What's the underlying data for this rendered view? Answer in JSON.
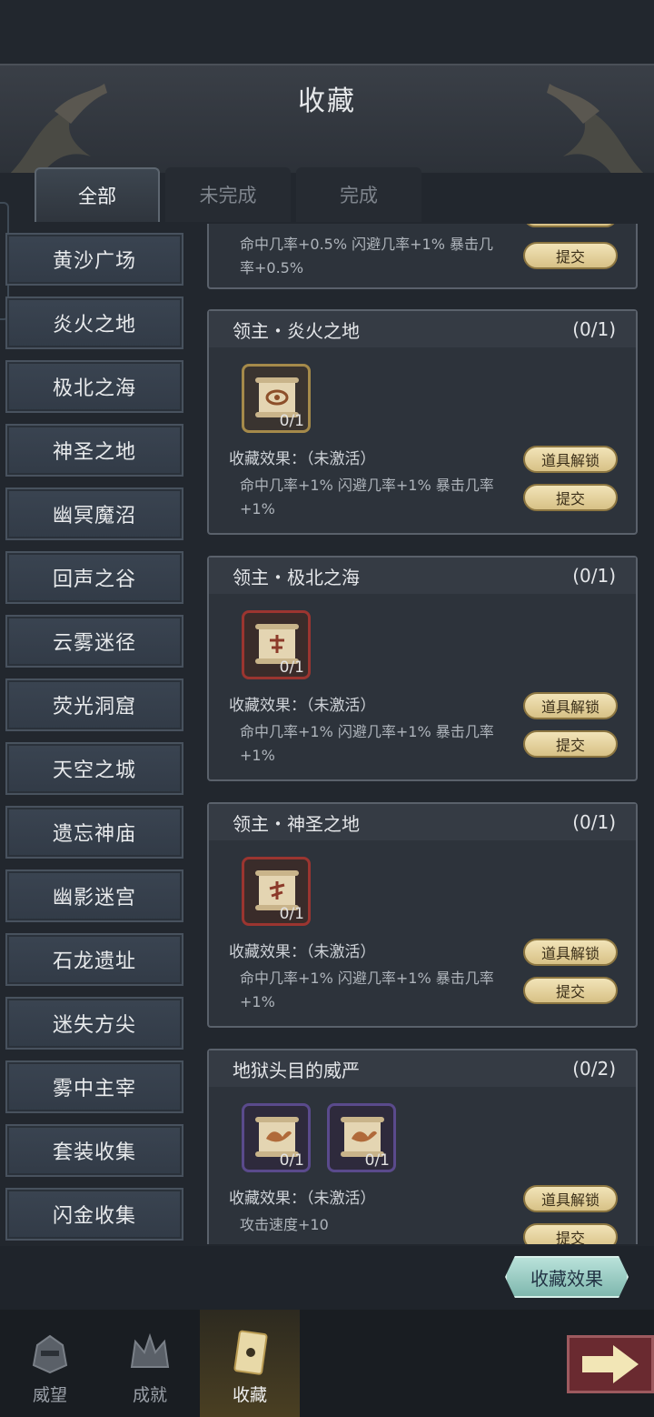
{
  "header": {
    "title": "收藏"
  },
  "tabs": [
    {
      "label": "全部",
      "active": true
    },
    {
      "label": "未完成",
      "active": false
    },
    {
      "label": "完成",
      "active": false
    }
  ],
  "sidebar": {
    "items": [
      {
        "label": "黄沙广场"
      },
      {
        "label": "炎火之地"
      },
      {
        "label": "极北之海"
      },
      {
        "label": "神圣之地"
      },
      {
        "label": "幽冥魔沼"
      },
      {
        "label": "回声之谷"
      },
      {
        "label": "云雾迷径"
      },
      {
        "label": "荧光洞窟"
      },
      {
        "label": "天空之城"
      },
      {
        "label": "遗忘神庙"
      },
      {
        "label": "幽影迷宫"
      },
      {
        "label": "石龙遗址"
      },
      {
        "label": "迷失方尖"
      },
      {
        "label": "雾中主宰"
      },
      {
        "label": "套装收集"
      },
      {
        "label": "闪金收集"
      }
    ]
  },
  "cards": [
    {
      "stats_line1": "命中几率+0.5% 闪避几率+1% 暴击几",
      "stats_line2": "率+0.5%",
      "submit_label": "提交"
    },
    {
      "title": "领主・炎火之地",
      "progress": "(0/1)",
      "items": [
        {
          "count": "0/1",
          "frame": "gold",
          "icon": "scroll-eye-icon"
        }
      ],
      "effect_label": "收藏效果：（未激活）",
      "stats_line1": "命中几率+1% 闪避几率+1% 暴击几率",
      "stats_line2": "+1%",
      "unlock_label": "道具解锁",
      "submit_label": "提交"
    },
    {
      "title": "领主・极北之海",
      "progress": "(0/1)",
      "items": [
        {
          "count": "0/1",
          "frame": "red",
          "icon": "scroll-rune-icon"
        }
      ],
      "effect_label": "收藏效果：（未激活）",
      "stats_line1": "命中几率+1% 闪避几率+1% 暴击几率",
      "stats_line2": "+1%",
      "unlock_label": "道具解锁",
      "submit_label": "提交"
    },
    {
      "title": "领主・神圣之地",
      "progress": "(0/1)",
      "items": [
        {
          "count": "0/1",
          "frame": "red",
          "icon": "scroll-rune-icon"
        }
      ],
      "effect_label": "收藏效果：（未激活）",
      "stats_line1": "命中几率+1% 闪避几率+1% 暴击几率",
      "stats_line2": "+1%",
      "unlock_label": "道具解锁",
      "submit_label": "提交"
    },
    {
      "title": "地狱头目的威严",
      "progress": "(0/2)",
      "items": [
        {
          "count": "0/1",
          "frame": "purple",
          "icon": "scroll-bird-icon"
        },
        {
          "count": "0/1",
          "frame": "purple",
          "icon": "scroll-bird-icon"
        }
      ],
      "effect_label": "收藏效果：（未激活）",
      "stats_line1": "攻击速度+10",
      "unlock_label": "道具解锁",
      "submit_label": "提交"
    }
  ],
  "effect_button": "收藏效果",
  "nav": [
    {
      "label": "威望",
      "icon": "helmet-icon",
      "active": false
    },
    {
      "label": "成就",
      "icon": "crown-icon",
      "active": false
    },
    {
      "label": "收藏",
      "icon": "card-icon",
      "active": true
    }
  ],
  "colors": {
    "accent_gold": "#d7c186",
    "panel": "#2d333b",
    "effect_teal": "#7fb8ae"
  }
}
